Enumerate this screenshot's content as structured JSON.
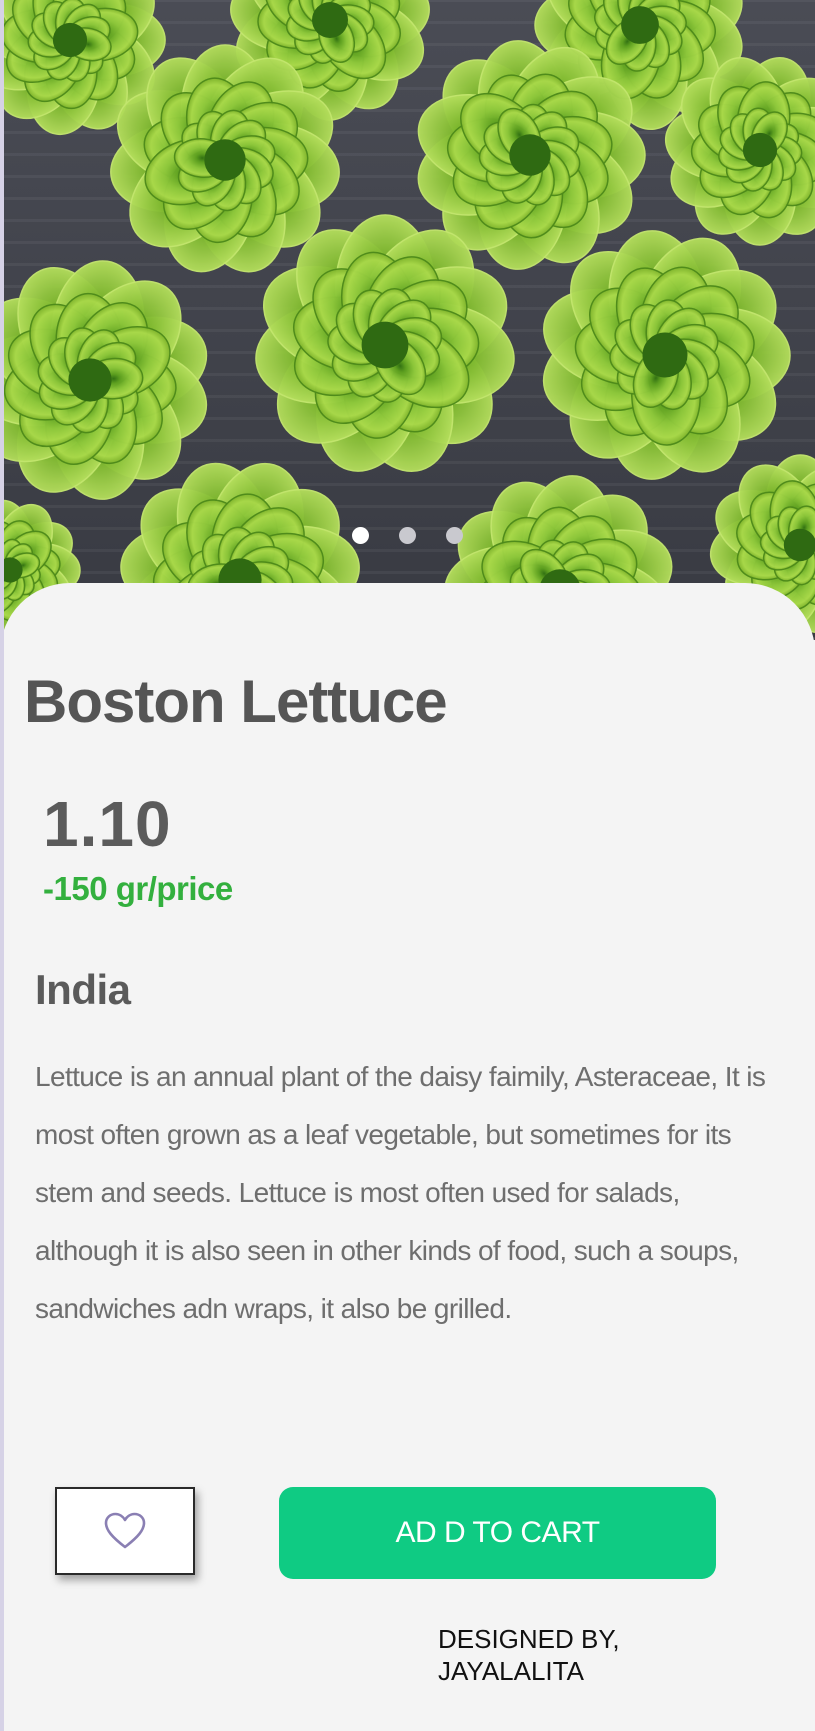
{
  "hero": {
    "image_subject": "lettuce-heads",
    "carousel": {
      "total": 3,
      "active_index": 0
    }
  },
  "product": {
    "name": "Boston Lettuce",
    "price": "1.10",
    "unit": "-150 gr/price",
    "origin": "India",
    "description": "Lettuce is an annual plant of the  daisy faimily, Asteraceae, It is most often grown as a leaf vegetable, but sometimes for its stem and seeds. Lettuce is most often used for salads, although it is also seen in other kinds of food, such a soups, sandwiches adn wraps, it also be grilled."
  },
  "actions": {
    "favorite_icon": "heart-outline-icon",
    "add_to_cart_label": "AD D TO CART"
  },
  "footer": {
    "credit_line1": "DESIGNED BY,",
    "credit_line2": "JAYALALITA"
  },
  "colors": {
    "accent_green": "#0fcb83",
    "unit_green": "#33b03e",
    "title_gray": "#555555",
    "background": "#f4f4f4"
  }
}
